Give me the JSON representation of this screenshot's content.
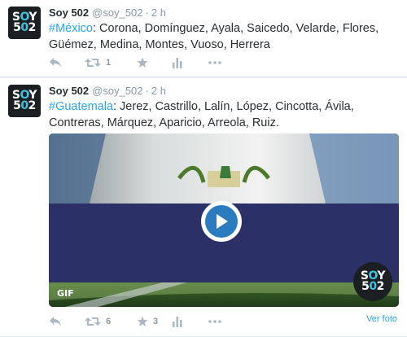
{
  "tweets": [
    {
      "avatar": {
        "line1": [
          "S",
          "O",
          "Y"
        ],
        "line2": [
          "5",
          "0",
          "2"
        ]
      },
      "name": "Soy 502",
      "handle": "@soy_502",
      "separator": "·",
      "time": "2 h",
      "hashtag": "#México",
      "text": ": Corona, Domínguez, Ayala, Saicedo, Velarde, Flores, Güémez, Medina, Montes, Vuoso, Herrera",
      "actions": {
        "reply": "",
        "retweet": "1",
        "favorite": "",
        "analytics": "",
        "more": ""
      }
    },
    {
      "avatar": {
        "line1": [
          "S",
          "O",
          "Y"
        ],
        "line2": [
          "5",
          "0",
          "2"
        ]
      },
      "name": "Soy 502",
      "handle": "@soy_502",
      "separator": "·",
      "time": "2 h",
      "hashtag": "#Guatemala",
      "text": ": Jerez, Castrillo, Lalín, López, Cincotta, Ávila, Contreras, Márquez, Aparicio, Arreola, Ruiz.",
      "media": {
        "gif_label": "GIF",
        "link": "Ver foto"
      },
      "actions": {
        "reply": "",
        "retweet": "6",
        "favorite": "3",
        "analytics": "",
        "more": ""
      }
    }
  ],
  "colors": {
    "accent": "#2aa3ef",
    "icon": "#aab8c2",
    "flag_blue": "#2b3066"
  }
}
